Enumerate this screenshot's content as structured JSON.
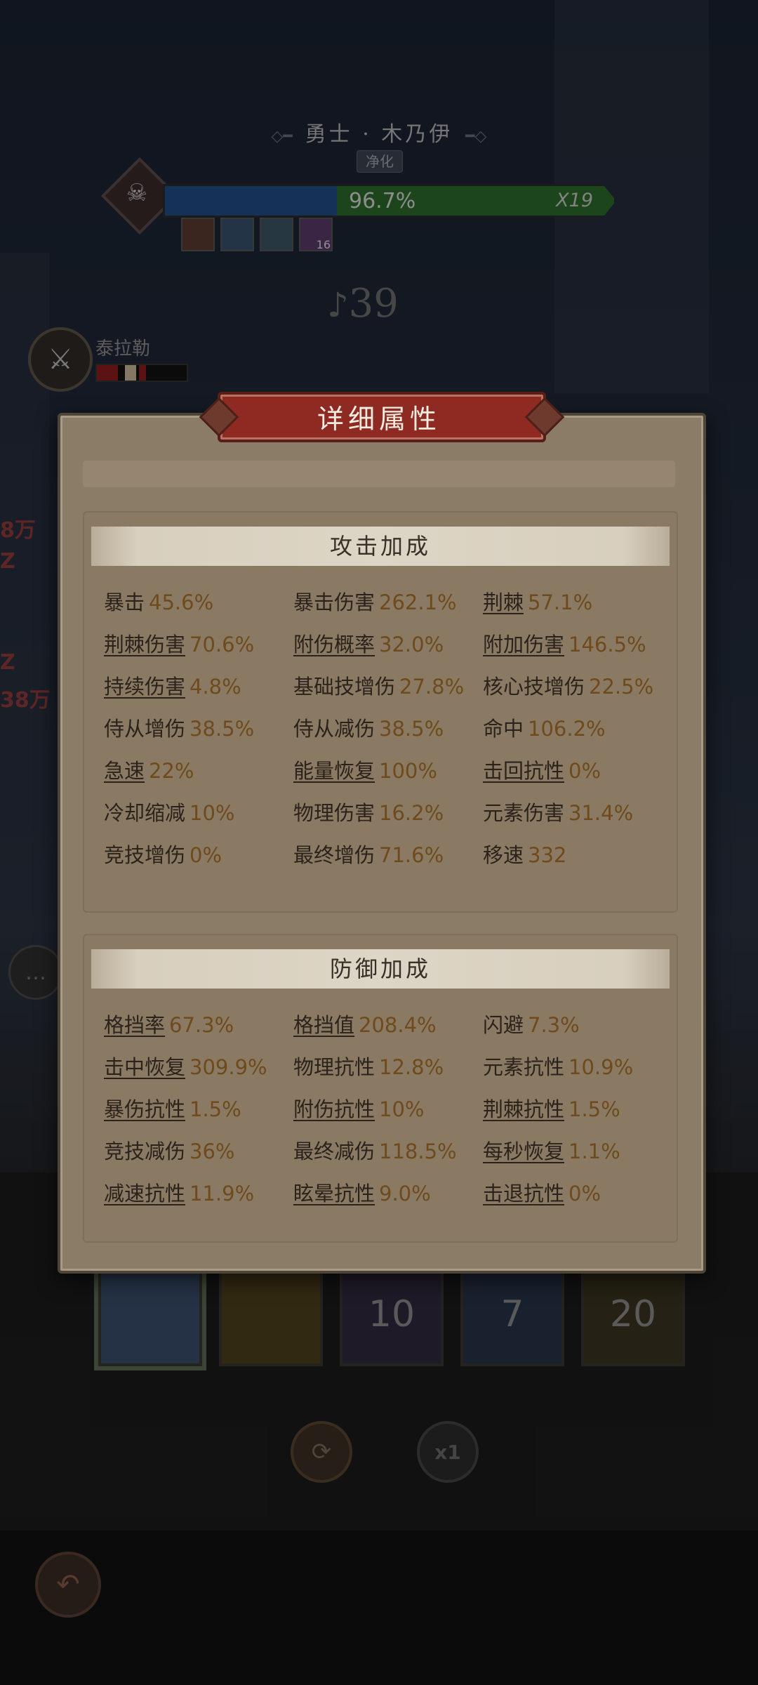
{
  "boss": {
    "name": "勇士 · 木乃伊",
    "subtitle": "净化",
    "hp_percent_text": "96.7%",
    "hp_fraction": 0.967,
    "multiplier": "X19",
    "buff_stack": "16"
  },
  "counter": "39",
  "hero": {
    "name": "泰拉勒"
  },
  "side_numbers": [
    "8万",
    "Z",
    "Z",
    "38万"
  ],
  "panel": {
    "title": "详细属性",
    "attack_section": {
      "title": "攻击加成",
      "stats": [
        {
          "label": "暴击",
          "value": "45.6%",
          "link": false
        },
        {
          "label": "暴击伤害",
          "value": "262.1%",
          "link": false
        },
        {
          "label": "荆棘",
          "value": "57.1%",
          "link": true
        },
        {
          "label": "荆棘伤害",
          "value": "70.6%",
          "link": true
        },
        {
          "label": "附伤概率",
          "value": "32.0%",
          "link": true
        },
        {
          "label": "附加伤害",
          "value": "146.5%",
          "link": true
        },
        {
          "label": "持续伤害",
          "value": "4.8%",
          "link": true
        },
        {
          "label": "基础技增伤",
          "value": "27.8%",
          "link": false
        },
        {
          "label": "核心技增伤",
          "value": "22.5%",
          "link": false
        },
        {
          "label": "侍从增伤",
          "value": "38.5%",
          "link": false
        },
        {
          "label": "侍从减伤",
          "value": "38.5%",
          "link": false
        },
        {
          "label": "命中",
          "value": "106.2%",
          "link": false
        },
        {
          "label": "急速",
          "value": "22%",
          "link": true
        },
        {
          "label": "能量恢复",
          "value": "100%",
          "link": true
        },
        {
          "label": "击回抗性",
          "value": "0%",
          "link": true
        },
        {
          "label": "冷却缩减",
          "value": "10%",
          "link": false
        },
        {
          "label": "物理伤害",
          "value": "16.2%",
          "link": false
        },
        {
          "label": "元素伤害",
          "value": "31.4%",
          "link": false
        },
        {
          "label": "竞技增伤",
          "value": "0%",
          "link": false
        },
        {
          "label": "最终增伤",
          "value": "71.6%",
          "link": false
        },
        {
          "label": "移速",
          "value": "332",
          "link": false
        }
      ]
    },
    "defense_section": {
      "title": "防御加成",
      "stats": [
        {
          "label": "格挡率",
          "value": "67.3%",
          "link": true
        },
        {
          "label": "格挡值",
          "value": "208.4%",
          "link": true
        },
        {
          "label": "闪避",
          "value": "7.3%",
          "link": false
        },
        {
          "label": "击中恢复",
          "value": "309.9%",
          "link": true
        },
        {
          "label": "物理抗性",
          "value": "12.8%",
          "link": false
        },
        {
          "label": "元素抗性",
          "value": "10.9%",
          "link": false
        },
        {
          "label": "暴伤抗性",
          "value": "1.5%",
          "link": true
        },
        {
          "label": "附伤抗性",
          "value": "10%",
          "link": true
        },
        {
          "label": "荆棘抗性",
          "value": "1.5%",
          "link": true
        },
        {
          "label": "竞技减伤",
          "value": "36%",
          "link": false
        },
        {
          "label": "最终减伤",
          "value": "118.5%",
          "link": false
        },
        {
          "label": "每秒恢复",
          "value": "1.1%",
          "link": true
        },
        {
          "label": "减速抗性",
          "value": "11.9%",
          "link": true
        },
        {
          "label": "眩晕抗性",
          "value": "9.0%",
          "link": true
        },
        {
          "label": "击退抗性",
          "value": "0%",
          "link": true
        }
      ]
    }
  },
  "skills": [
    {
      "name": "lightning-skill",
      "label": ""
    },
    {
      "name": "whirl-skill",
      "label": ""
    },
    {
      "name": "shadow-skill",
      "label": "10"
    },
    {
      "name": "ghost-skill",
      "label": "7"
    },
    {
      "name": "burst-skill",
      "label": "20"
    }
  ],
  "controls": {
    "speed": "x1"
  },
  "icons": {
    "counter": "music-note-icon",
    "refresh": "refresh-icon",
    "back": "back-arrow-icon",
    "chat": "chat-icon"
  },
  "colors": {
    "hp_blue": "#234c86",
    "hp_green": "#2c6a2c",
    "title_plate": "#8e2a22",
    "value_text": "#6e4a1c"
  }
}
